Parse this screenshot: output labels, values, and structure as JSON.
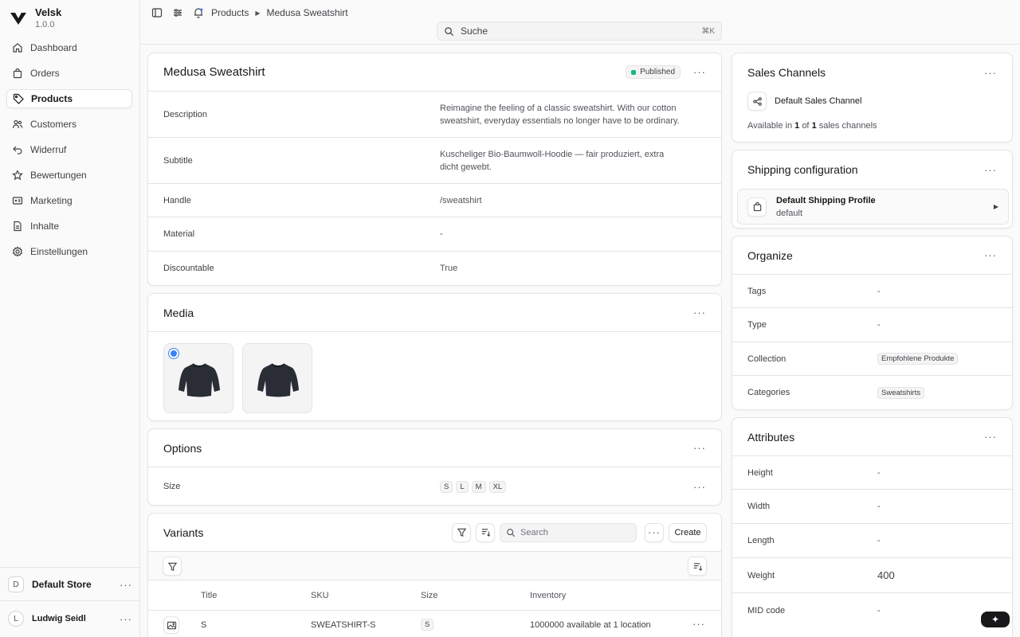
{
  "brand": {
    "name": "Velsk",
    "version": "1.0.0"
  },
  "nav": [
    {
      "label": "Dashboard",
      "icon": "home-icon"
    },
    {
      "label": "Orders",
      "icon": "shopping-bag-icon"
    },
    {
      "label": "Products",
      "icon": "tag-icon",
      "active": true
    },
    {
      "label": "Customers",
      "icon": "users-icon"
    },
    {
      "label": "Widerruf",
      "icon": "undo-arrow-icon"
    },
    {
      "label": "Bewertungen",
      "icon": "star-icon"
    },
    {
      "label": "Marketing",
      "icon": "receipt-icon"
    },
    {
      "label": "Inhalte",
      "icon": "document-icon"
    },
    {
      "label": "Einstellungen",
      "icon": "gear-icon"
    }
  ],
  "store": {
    "initial": "D",
    "name": "Default Store"
  },
  "user": {
    "initial": "L",
    "name": "Ludwig Seidl"
  },
  "breadcrumb": {
    "parent": "Products",
    "current": "Medusa Sweatshirt"
  },
  "search": {
    "placeholder": "Suche",
    "shortcut": "⌘K"
  },
  "product": {
    "title": "Medusa Sweatshirt",
    "status": "Published",
    "status_color": "#10b981",
    "fields": [
      {
        "label": "Description",
        "value": "Reimagine the feeling of a classic sweatshirt. With our cotton sweatshirt, everyday essentials no longer have to be ordinary."
      },
      {
        "label": "Subtitle",
        "value": "Kuscheliger Bio-Baumwoll-Hoodie — fair produziert, extra dicht gewebt."
      },
      {
        "label": "Handle",
        "value": "/sweatshirt"
      },
      {
        "label": "Material",
        "value": "-"
      },
      {
        "label": "Discountable",
        "value": "True"
      }
    ]
  },
  "media": {
    "title": "Media"
  },
  "options": {
    "title": "Options",
    "label": "Size",
    "values": [
      "S",
      "L",
      "M",
      "XL"
    ]
  },
  "variants": {
    "title": "Variants",
    "search_placeholder": "Search",
    "create_label": "Create",
    "columns": [
      "Title",
      "SKU",
      "Size",
      "Inventory"
    ],
    "rows": [
      {
        "title": "S",
        "sku": "SWEATSHIRT-S",
        "size": "S",
        "inventory": "1000000 available at 1 location"
      }
    ]
  },
  "sales_channels": {
    "title": "Sales Channels",
    "channel": "Default Sales Channel",
    "avail_prefix": "Available in",
    "avail_count": "1",
    "avail_of": "of",
    "avail_total": "1",
    "avail_suffix": "sales channels"
  },
  "shipping": {
    "title": "Shipping configuration",
    "profile": "Default Shipping Profile",
    "profile_type": "default"
  },
  "organize": {
    "title": "Organize",
    "rows": [
      {
        "label": "Tags",
        "value": "-"
      },
      {
        "label": "Type",
        "value": "-"
      },
      {
        "label": "Collection",
        "value": "Empfohlene Produkte"
      },
      {
        "label": "Categories",
        "value": "Sweatshirts"
      }
    ]
  },
  "attributes": {
    "title": "Attributes",
    "rows": [
      {
        "label": "Height",
        "value": "-"
      },
      {
        "label": "Width",
        "value": "-"
      },
      {
        "label": "Length",
        "value": "-"
      },
      {
        "label": "Weight",
        "value": "400"
      },
      {
        "label": "MID code",
        "value": "-"
      }
    ]
  }
}
